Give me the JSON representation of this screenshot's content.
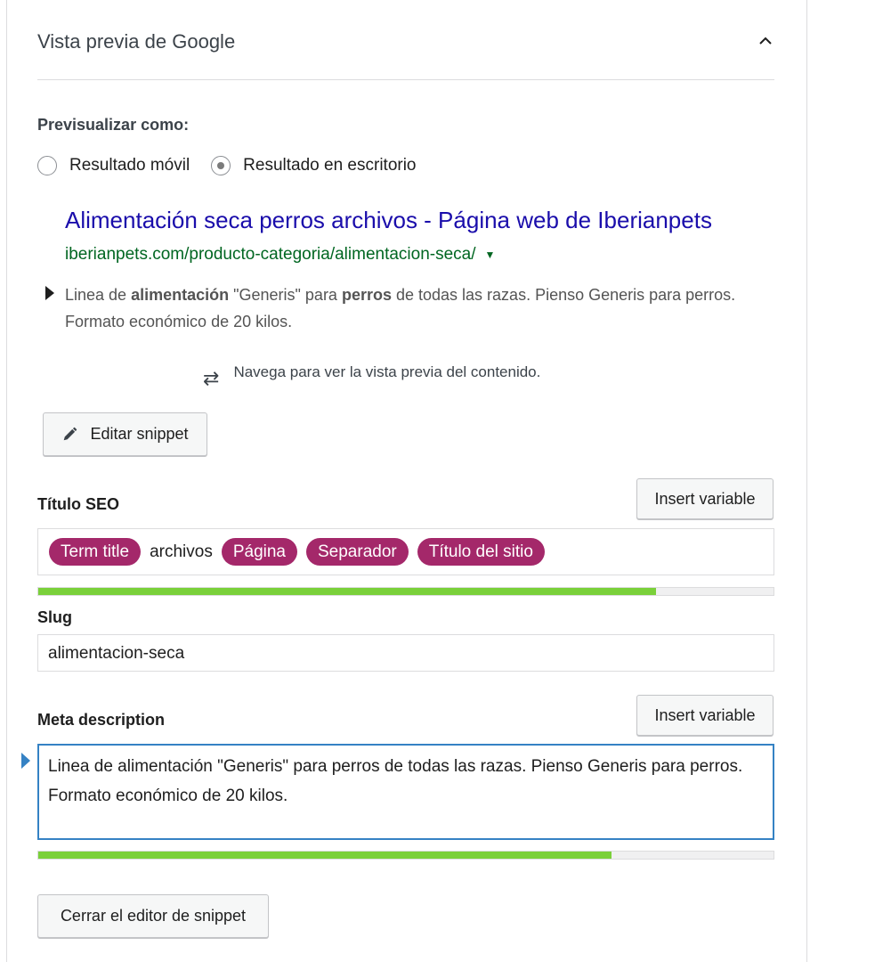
{
  "panel": {
    "title": "Vista previa de Google"
  },
  "preview": {
    "label": "Previsualizar como:",
    "options": [
      {
        "label": "Resultado móvil",
        "checked": false
      },
      {
        "label": "Resultado en escritorio",
        "checked": true
      }
    ]
  },
  "serp": {
    "title": "Alimentación seca perros archivos - Página web de Iberianpets",
    "url": "iberianpets.com/producto-categoria/alimentacion-seca/",
    "url_caret": "▼",
    "desc_part1": "Linea de ",
    "desc_bold1": "alimentación",
    "desc_part2": " \"Generis\" para ",
    "desc_bold2": "perros",
    "desc_part3": " de todas las razas. Pienso Generis para perros.",
    "desc_line2": "Formato económico de 20 kilos.",
    "nav_hint": "Navega para ver la vista previa del contenido.",
    "nav_icon": "⇄"
  },
  "buttons": {
    "edit_snippet": "Editar snippet",
    "insert_variable": "Insert variable",
    "close_editor": "Cerrar el editor de snippet"
  },
  "seo_title": {
    "label": "Título SEO",
    "tokens": [
      {
        "text": "Term title",
        "type": "pill"
      },
      {
        "text": "archivos",
        "type": "text"
      },
      {
        "text": "Página",
        "type": "pill"
      },
      {
        "text": "Separador",
        "type": "pill"
      },
      {
        "text": "Título del sitio",
        "type": "pill"
      }
    ],
    "progress": 0.84
  },
  "slug": {
    "label": "Slug",
    "value": "alimentacion-seca"
  },
  "meta": {
    "label": "Meta description",
    "value": "Linea de alimentación \"Generis\" para perros de todas las razas. Pienso Generis para perros. Formato económico de 20 kilos.",
    "progress": 0.78
  },
  "colors": {
    "pill": "#a4286a",
    "progress_good": "#7ad03a",
    "serp_title": "#1a0dab",
    "serp_url": "#006621",
    "focus": "#3582c4"
  }
}
